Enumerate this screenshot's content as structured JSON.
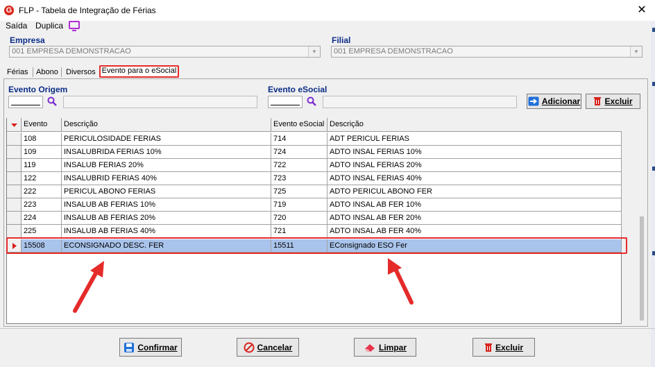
{
  "window": {
    "title": "FLP - Tabela de Integração de Férias",
    "logo_letter": "G"
  },
  "menu": {
    "items": [
      "Saída",
      "Duplica"
    ]
  },
  "empresa": {
    "label": "Empresa",
    "value": "001 EMPRESA DEMONSTRACAO"
  },
  "filial": {
    "label": "Filial",
    "value": "001 EMPRESA DEMONSTRACAO"
  },
  "tabs": [
    "Férias",
    "Abono",
    "Diversos",
    "Evento para o eSocial"
  ],
  "active_tab": "Evento para o eSocial",
  "filters": {
    "origem_label": "Evento Origem",
    "esocial_label": "Evento eSocial",
    "add_button": "Adicionar",
    "delete_button": "Excluir"
  },
  "table": {
    "columns": [
      "Evento",
      "Descrição",
      "Evento eSocial",
      "Descrição"
    ],
    "rows": [
      [
        "108",
        "PERICULOSIDADE FERIAS",
        "714",
        "ADT PERICUL FERIAS"
      ],
      [
        "109",
        "INSALUBRIDA FERIAS 10%",
        "724",
        "ADTO INSAL FERIAS 10%"
      ],
      [
        "119",
        "INSALUB FERIAS 20%",
        "722",
        "ADTO INSAL FERIAS 20%"
      ],
      [
        "122",
        "INSALUBRID FERIAS 40%",
        "723",
        "ADTO INSAL FERIAS 40%"
      ],
      [
        "222",
        "PERICUL ABONO FERIAS",
        "725",
        "ADTO PERICUL ABONO FER"
      ],
      [
        "223",
        "INSALUB AB FERIAS 10%",
        "719",
        "ADTO INSAL AB FER 10%"
      ],
      [
        "224",
        "INSALUB AB FERIAS 20%",
        "720",
        "ADTO INSAL AB FER 20%"
      ],
      [
        "225",
        "INSALUB AB FERIAS 40%",
        "721",
        "ADTO INSAL AB FER 40%"
      ],
      [
        "15508",
        "ECONSIGNADO DESC. FER",
        "15511",
        "EConsignado ESO Fer"
      ]
    ],
    "selected_row": 8
  },
  "footer": {
    "confirm": "Confirmar",
    "cancel": "Cancelar",
    "clear": "Limpar",
    "delete": "Excluir"
  },
  "colors": {
    "highlight": "#e52a2a",
    "label": "#0a2c86",
    "selection": "#a9c4ec"
  }
}
